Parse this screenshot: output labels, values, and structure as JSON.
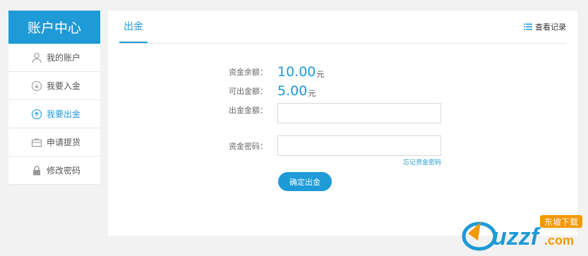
{
  "sidebar": {
    "title": "账户中心",
    "items": [
      {
        "label": "我的账户",
        "icon": "user-icon"
      },
      {
        "label": "我要入金",
        "icon": "deposit-icon"
      },
      {
        "label": "我要出金",
        "icon": "withdraw-icon"
      },
      {
        "label": "申请提货",
        "icon": "briefcase-icon"
      },
      {
        "label": "修改密码",
        "icon": "lock-icon"
      }
    ],
    "active_index": 2
  },
  "main": {
    "tab_label": "出金",
    "view_records_label": "查看记录",
    "form": {
      "balance_label": "资金余额：",
      "balance_value": "10.00",
      "balance_unit": "元",
      "withdrawable_label": "可出金额：",
      "withdrawable_value": "5.00",
      "withdrawable_unit": "元",
      "amount_label": "出金金额：",
      "amount_value": "",
      "password_label": "资金密码：",
      "password_value": "",
      "forgot_password_link": "忘记资金密码",
      "confirm_button": "确定出金"
    }
  },
  "watermark": {
    "text": "uzzf.com",
    "badge": "东坡下载"
  },
  "colors": {
    "accent": "#1e9ad6",
    "background": "#f2f2f2"
  }
}
